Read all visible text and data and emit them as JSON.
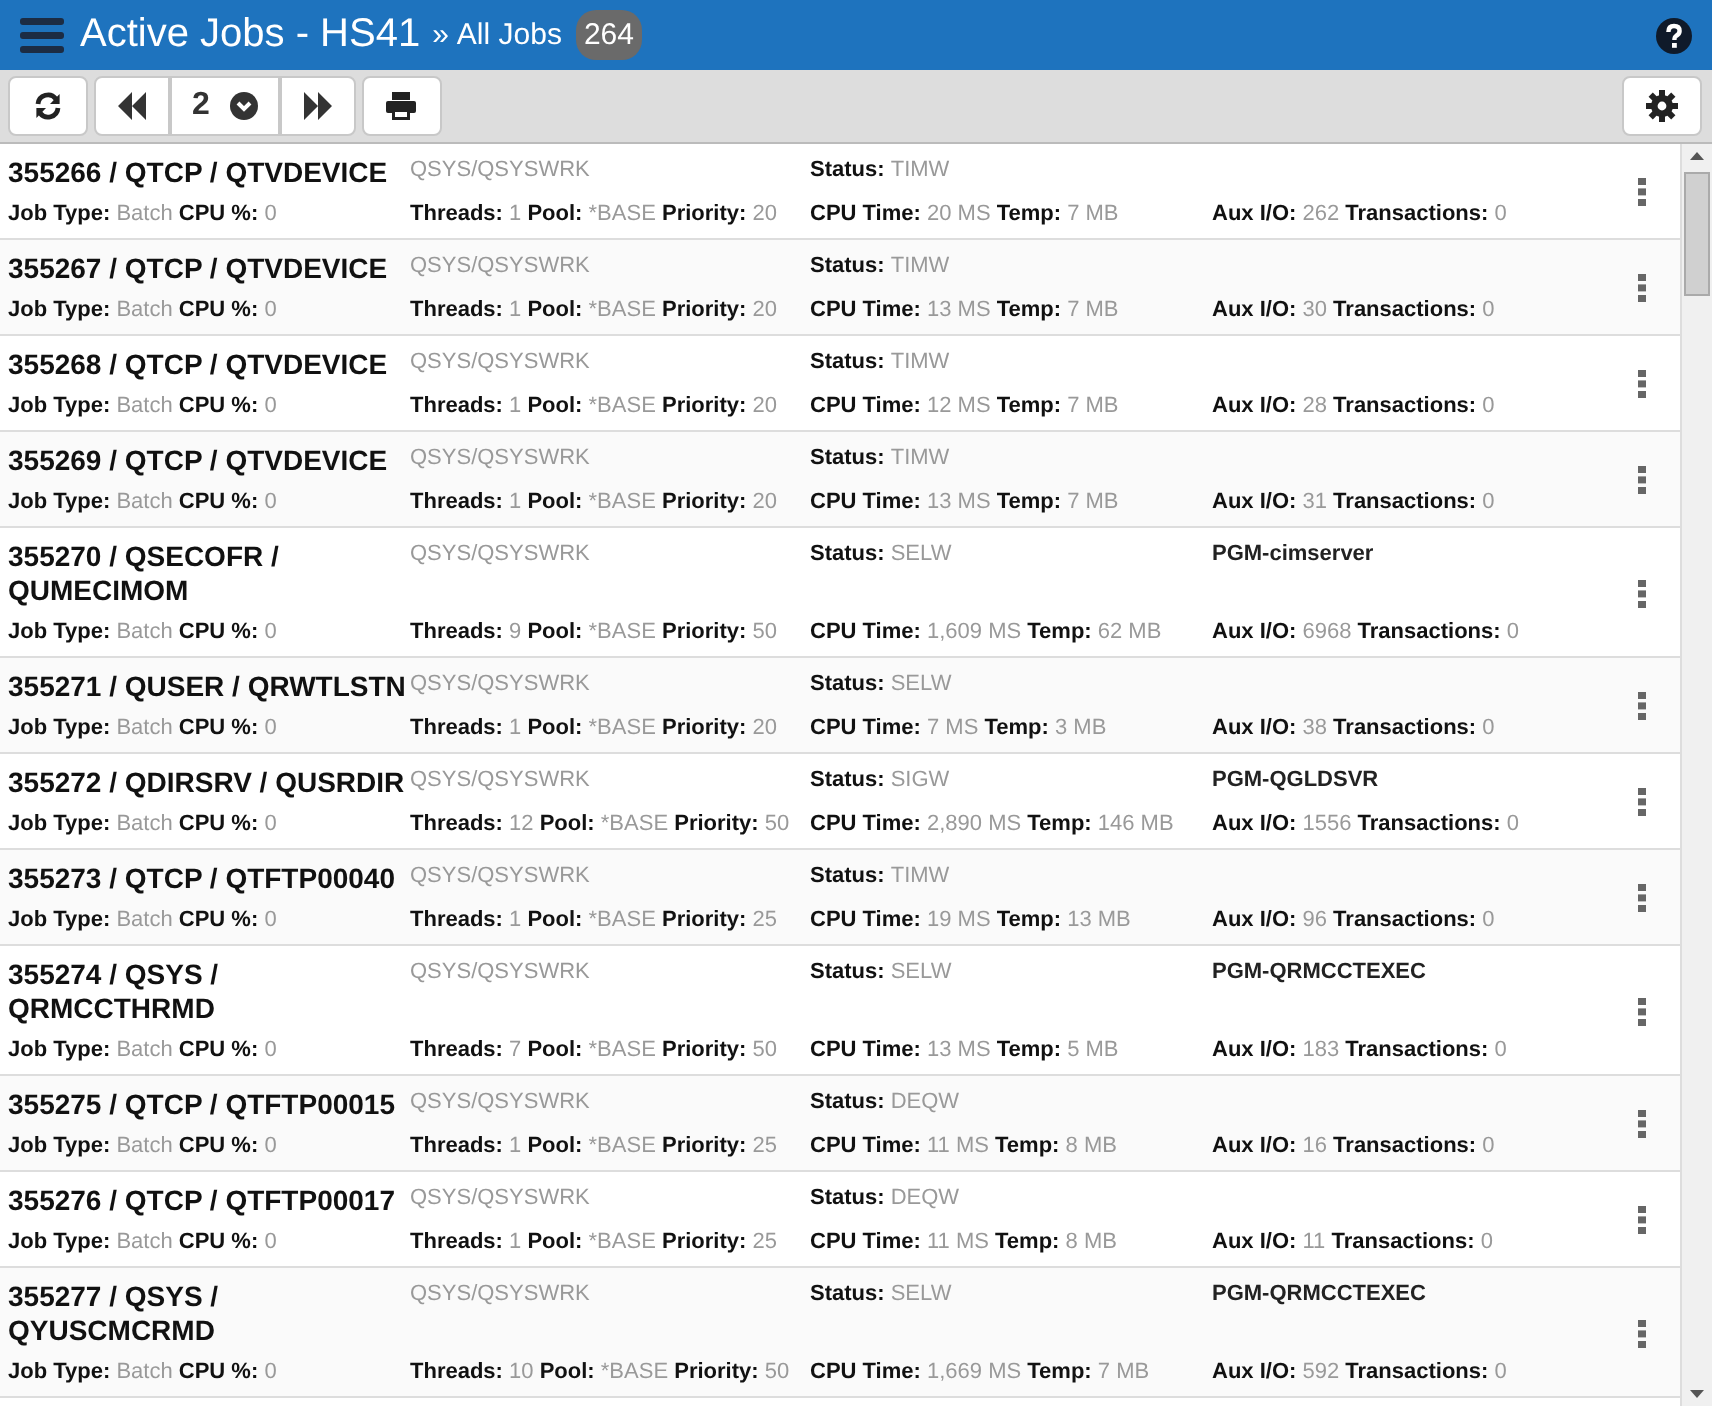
{
  "header": {
    "title": "Active Jobs - HS41",
    "separator": "»",
    "subtitle": "All Jobs",
    "count": "264"
  },
  "toolbar": {
    "page": "2"
  },
  "jobs": [
    {
      "title": "355266 / QTCP / QTVDEVICE",
      "subsystem": "QSYS/QSYSWRK",
      "status": [
        "Status:",
        "TIMW"
      ],
      "stats": [
        [
          [
            "Job Type:",
            "Batch"
          ],
          [
            "CPU %:",
            "0"
          ]
        ],
        [
          [
            "Threads:",
            "1"
          ],
          [
            "Pool:",
            "*BASE"
          ],
          [
            "Priority:",
            "20"
          ]
        ],
        [
          [
            "CPU Time:",
            "20 MS"
          ],
          [
            "Temp:",
            "7 MB"
          ]
        ],
        [
          [
            "Aux I/O:",
            "262"
          ],
          [
            "Transactions:",
            "0"
          ]
        ]
      ]
    },
    {
      "title": "355267 / QTCP / QTVDEVICE",
      "subsystem": "QSYS/QSYSWRK",
      "status": [
        "Status:",
        "TIMW"
      ],
      "stats": [
        [
          [
            "Job Type:",
            "Batch"
          ],
          [
            "CPU %:",
            "0"
          ]
        ],
        [
          [
            "Threads:",
            "1"
          ],
          [
            "Pool:",
            "*BASE"
          ],
          [
            "Priority:",
            "20"
          ]
        ],
        [
          [
            "CPU Time:",
            "13 MS"
          ],
          [
            "Temp:",
            "7 MB"
          ]
        ],
        [
          [
            "Aux I/O:",
            "30"
          ],
          [
            "Transactions:",
            "0"
          ]
        ]
      ]
    },
    {
      "title": "355268 / QTCP / QTVDEVICE",
      "subsystem": "QSYS/QSYSWRK",
      "status": [
        "Status:",
        "TIMW"
      ],
      "stats": [
        [
          [
            "Job Type:",
            "Batch"
          ],
          [
            "CPU %:",
            "0"
          ]
        ],
        [
          [
            "Threads:",
            "1"
          ],
          [
            "Pool:",
            "*BASE"
          ],
          [
            "Priority:",
            "20"
          ]
        ],
        [
          [
            "CPU Time:",
            "12 MS"
          ],
          [
            "Temp:",
            "7 MB"
          ]
        ],
        [
          [
            "Aux I/O:",
            "28"
          ],
          [
            "Transactions:",
            "0"
          ]
        ]
      ]
    },
    {
      "title": "355269 / QTCP / QTVDEVICE",
      "subsystem": "QSYS/QSYSWRK",
      "status": [
        "Status:",
        "TIMW"
      ],
      "stats": [
        [
          [
            "Job Type:",
            "Batch"
          ],
          [
            "CPU %:",
            "0"
          ]
        ],
        [
          [
            "Threads:",
            "1"
          ],
          [
            "Pool:",
            "*BASE"
          ],
          [
            "Priority:",
            "20"
          ]
        ],
        [
          [
            "CPU Time:",
            "13 MS"
          ],
          [
            "Temp:",
            "7 MB"
          ]
        ],
        [
          [
            "Aux I/O:",
            "31"
          ],
          [
            "Transactions:",
            "0"
          ]
        ]
      ]
    },
    {
      "title": "355270 / QSECOFR / QUMECIMOM",
      "subsystem": "QSYS/QSYSWRK",
      "status": [
        "Status:",
        "SELW"
      ],
      "program": "PGM-cimserver",
      "stats": [
        [
          [
            "Job Type:",
            "Batch"
          ],
          [
            "CPU %:",
            "0"
          ]
        ],
        [
          [
            "Threads:",
            "9"
          ],
          [
            "Pool:",
            "*BASE"
          ],
          [
            "Priority:",
            "50"
          ]
        ],
        [
          [
            "CPU Time:",
            "1,609 MS"
          ],
          [
            "Temp:",
            "62 MB"
          ]
        ],
        [
          [
            "Aux I/O:",
            "6968"
          ],
          [
            "Transactions:",
            "0"
          ]
        ]
      ]
    },
    {
      "title": "355271 / QUSER / QRWTLSTN",
      "subsystem": "QSYS/QSYSWRK",
      "status": [
        "Status:",
        "SELW"
      ],
      "stats": [
        [
          [
            "Job Type:",
            "Batch"
          ],
          [
            "CPU %:",
            "0"
          ]
        ],
        [
          [
            "Threads:",
            "1"
          ],
          [
            "Pool:",
            "*BASE"
          ],
          [
            "Priority:",
            "20"
          ]
        ],
        [
          [
            "CPU Time:",
            "7 MS"
          ],
          [
            "Temp:",
            "3 MB"
          ]
        ],
        [
          [
            "Aux I/O:",
            "38"
          ],
          [
            "Transactions:",
            "0"
          ]
        ]
      ]
    },
    {
      "title": "355272 / QDIRSRV / QUSRDIR",
      "subsystem": "QSYS/QSYSWRK",
      "status": [
        "Status:",
        "SIGW"
      ],
      "program": "PGM-QGLDSVR",
      "stats": [
        [
          [
            "Job Type:",
            "Batch"
          ],
          [
            "CPU %:",
            "0"
          ]
        ],
        [
          [
            "Threads:",
            "12"
          ],
          [
            "Pool:",
            "*BASE"
          ],
          [
            "Priority:",
            "50"
          ]
        ],
        [
          [
            "CPU Time:",
            "2,890 MS"
          ],
          [
            "Temp:",
            "146 MB"
          ]
        ],
        [
          [
            "Aux I/O:",
            "1556"
          ],
          [
            "Transactions:",
            "0"
          ]
        ]
      ]
    },
    {
      "title": "355273 / QTCP / QTFTP00040",
      "subsystem": "QSYS/QSYSWRK",
      "status": [
        "Status:",
        "TIMW"
      ],
      "stats": [
        [
          [
            "Job Type:",
            "Batch"
          ],
          [
            "CPU %:",
            "0"
          ]
        ],
        [
          [
            "Threads:",
            "1"
          ],
          [
            "Pool:",
            "*BASE"
          ],
          [
            "Priority:",
            "25"
          ]
        ],
        [
          [
            "CPU Time:",
            "19 MS"
          ],
          [
            "Temp:",
            "13 MB"
          ]
        ],
        [
          [
            "Aux I/O:",
            "96"
          ],
          [
            "Transactions:",
            "0"
          ]
        ]
      ]
    },
    {
      "title": "355274 / QSYS / QRMCCTHRMD",
      "subsystem": "QSYS/QSYSWRK",
      "status": [
        "Status:",
        "SELW"
      ],
      "program": "PGM-QRMCCTEXEC",
      "stats": [
        [
          [
            "Job Type:",
            "Batch"
          ],
          [
            "CPU %:",
            "0"
          ]
        ],
        [
          [
            "Threads:",
            "7"
          ],
          [
            "Pool:",
            "*BASE"
          ],
          [
            "Priority:",
            "50"
          ]
        ],
        [
          [
            "CPU Time:",
            "13 MS"
          ],
          [
            "Temp:",
            "5 MB"
          ]
        ],
        [
          [
            "Aux I/O:",
            "183"
          ],
          [
            "Transactions:",
            "0"
          ]
        ]
      ]
    },
    {
      "title": "355275 / QTCP / QTFTP00015",
      "subsystem": "QSYS/QSYSWRK",
      "status": [
        "Status:",
        "DEQW"
      ],
      "stats": [
        [
          [
            "Job Type:",
            "Batch"
          ],
          [
            "CPU %:",
            "0"
          ]
        ],
        [
          [
            "Threads:",
            "1"
          ],
          [
            "Pool:",
            "*BASE"
          ],
          [
            "Priority:",
            "25"
          ]
        ],
        [
          [
            "CPU Time:",
            "11 MS"
          ],
          [
            "Temp:",
            "8 MB"
          ]
        ],
        [
          [
            "Aux I/O:",
            "16"
          ],
          [
            "Transactions:",
            "0"
          ]
        ]
      ]
    },
    {
      "title": "355276 / QTCP / QTFTP00017",
      "subsystem": "QSYS/QSYSWRK",
      "status": [
        "Status:",
        "DEQW"
      ],
      "stats": [
        [
          [
            "Job Type:",
            "Batch"
          ],
          [
            "CPU %:",
            "0"
          ]
        ],
        [
          [
            "Threads:",
            "1"
          ],
          [
            "Pool:",
            "*BASE"
          ],
          [
            "Priority:",
            "25"
          ]
        ],
        [
          [
            "CPU Time:",
            "11 MS"
          ],
          [
            "Temp:",
            "8 MB"
          ]
        ],
        [
          [
            "Aux I/O:",
            "11"
          ],
          [
            "Transactions:",
            "0"
          ]
        ]
      ]
    },
    {
      "title": "355277 / QSYS / QYUSCMCRMD",
      "subsystem": "QSYS/QSYSWRK",
      "status": [
        "Status:",
        "SELW"
      ],
      "program": "PGM-QRMCCTEXEC",
      "stats": [
        [
          [
            "Job Type:",
            "Batch"
          ],
          [
            "CPU %:",
            "0"
          ]
        ],
        [
          [
            "Threads:",
            "10"
          ],
          [
            "Pool:",
            "*BASE"
          ],
          [
            "Priority:",
            "50"
          ]
        ],
        [
          [
            "CPU Time:",
            "1,669 MS"
          ],
          [
            "Temp:",
            "7 MB"
          ]
        ],
        [
          [
            "Aux I/O:",
            "592"
          ],
          [
            "Transactions:",
            "0"
          ]
        ]
      ]
    }
  ]
}
